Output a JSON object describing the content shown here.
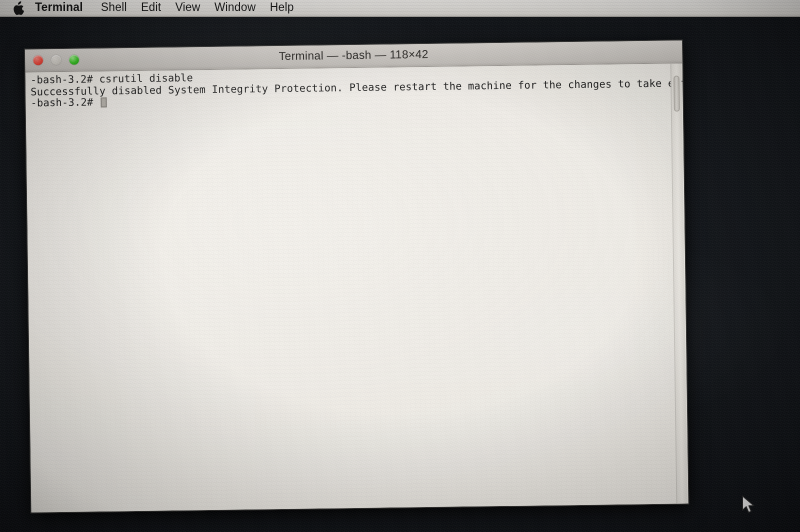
{
  "menubar": {
    "apple_icon": "apple-logo-icon",
    "items": [
      {
        "label": "Terminal",
        "bold": true
      },
      {
        "label": "Shell",
        "bold": false
      },
      {
        "label": "Edit",
        "bold": false
      },
      {
        "label": "View",
        "bold": false
      },
      {
        "label": "Window",
        "bold": false
      },
      {
        "label": "Help",
        "bold": false
      }
    ]
  },
  "window": {
    "title": "Terminal — -bash — 118×42",
    "traffic_lights": {
      "close_label": "Close",
      "minimize_label": "Minimize",
      "zoom_label": "Zoom"
    }
  },
  "terminal": {
    "lines": [
      "-bash-3.2# csrutil disable",
      "Successfully disabled System Integrity Protection. Please restart the machine for the changes to take effect.",
      "-bash-3.2# "
    ],
    "prompt": "-bash-3.2#",
    "command": "csrutil disable",
    "cursor": "block-cursor"
  },
  "desktop": {
    "cursor_icon": "mouse-arrow-cursor"
  },
  "colors": {
    "desktop_background": "#121519",
    "menubar_background": "#e9e7e3",
    "titlebar_background": "#d2cec9",
    "terminal_background": "#f3f0ea",
    "terminal_text": "#1c1c1c",
    "traffic_close": "#f5493c",
    "traffic_minimize": "#d4d0c9",
    "traffic_zoom": "#35c420"
  }
}
